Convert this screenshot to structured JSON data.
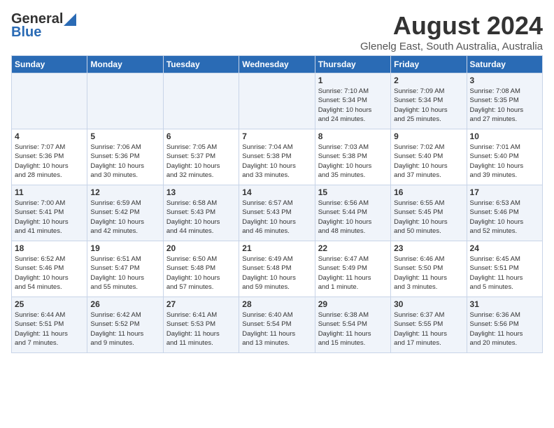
{
  "header": {
    "logo_general": "General",
    "logo_blue": "Blue",
    "title": "August 2024",
    "subtitle": "Glenelg East, South Australia, Australia"
  },
  "calendar": {
    "weekdays": [
      "Sunday",
      "Monday",
      "Tuesday",
      "Wednesday",
      "Thursday",
      "Friday",
      "Saturday"
    ],
    "weeks": [
      [
        {
          "day": "",
          "info": ""
        },
        {
          "day": "",
          "info": ""
        },
        {
          "day": "",
          "info": ""
        },
        {
          "day": "",
          "info": ""
        },
        {
          "day": "1",
          "info": "Sunrise: 7:10 AM\nSunset: 5:34 PM\nDaylight: 10 hours\nand 24 minutes."
        },
        {
          "day": "2",
          "info": "Sunrise: 7:09 AM\nSunset: 5:34 PM\nDaylight: 10 hours\nand 25 minutes."
        },
        {
          "day": "3",
          "info": "Sunrise: 7:08 AM\nSunset: 5:35 PM\nDaylight: 10 hours\nand 27 minutes."
        }
      ],
      [
        {
          "day": "4",
          "info": "Sunrise: 7:07 AM\nSunset: 5:36 PM\nDaylight: 10 hours\nand 28 minutes."
        },
        {
          "day": "5",
          "info": "Sunrise: 7:06 AM\nSunset: 5:36 PM\nDaylight: 10 hours\nand 30 minutes."
        },
        {
          "day": "6",
          "info": "Sunrise: 7:05 AM\nSunset: 5:37 PM\nDaylight: 10 hours\nand 32 minutes."
        },
        {
          "day": "7",
          "info": "Sunrise: 7:04 AM\nSunset: 5:38 PM\nDaylight: 10 hours\nand 33 minutes."
        },
        {
          "day": "8",
          "info": "Sunrise: 7:03 AM\nSunset: 5:38 PM\nDaylight: 10 hours\nand 35 minutes."
        },
        {
          "day": "9",
          "info": "Sunrise: 7:02 AM\nSunset: 5:40 PM\nDaylight: 10 hours\nand 37 minutes."
        },
        {
          "day": "10",
          "info": "Sunrise: 7:01 AM\nSunset: 5:40 PM\nDaylight: 10 hours\nand 39 minutes."
        }
      ],
      [
        {
          "day": "11",
          "info": "Sunrise: 7:00 AM\nSunset: 5:41 PM\nDaylight: 10 hours\nand 41 minutes."
        },
        {
          "day": "12",
          "info": "Sunrise: 6:59 AM\nSunset: 5:42 PM\nDaylight: 10 hours\nand 42 minutes."
        },
        {
          "day": "13",
          "info": "Sunrise: 6:58 AM\nSunset: 5:43 PM\nDaylight: 10 hours\nand 44 minutes."
        },
        {
          "day": "14",
          "info": "Sunrise: 6:57 AM\nSunset: 5:43 PM\nDaylight: 10 hours\nand 46 minutes."
        },
        {
          "day": "15",
          "info": "Sunrise: 6:56 AM\nSunset: 5:44 PM\nDaylight: 10 hours\nand 48 minutes."
        },
        {
          "day": "16",
          "info": "Sunrise: 6:55 AM\nSunset: 5:45 PM\nDaylight: 10 hours\nand 50 minutes."
        },
        {
          "day": "17",
          "info": "Sunrise: 6:53 AM\nSunset: 5:46 PM\nDaylight: 10 hours\nand 52 minutes."
        }
      ],
      [
        {
          "day": "18",
          "info": "Sunrise: 6:52 AM\nSunset: 5:46 PM\nDaylight: 10 hours\nand 54 minutes."
        },
        {
          "day": "19",
          "info": "Sunrise: 6:51 AM\nSunset: 5:47 PM\nDaylight: 10 hours\nand 55 minutes."
        },
        {
          "day": "20",
          "info": "Sunrise: 6:50 AM\nSunset: 5:48 PM\nDaylight: 10 hours\nand 57 minutes."
        },
        {
          "day": "21",
          "info": "Sunrise: 6:49 AM\nSunset: 5:48 PM\nDaylight: 10 hours\nand 59 minutes."
        },
        {
          "day": "22",
          "info": "Sunrise: 6:47 AM\nSunset: 5:49 PM\nDaylight: 11 hours\nand 1 minute."
        },
        {
          "day": "23",
          "info": "Sunrise: 6:46 AM\nSunset: 5:50 PM\nDaylight: 11 hours\nand 3 minutes."
        },
        {
          "day": "24",
          "info": "Sunrise: 6:45 AM\nSunset: 5:51 PM\nDaylight: 11 hours\nand 5 minutes."
        }
      ],
      [
        {
          "day": "25",
          "info": "Sunrise: 6:44 AM\nSunset: 5:51 PM\nDaylight: 11 hours\nand 7 minutes."
        },
        {
          "day": "26",
          "info": "Sunrise: 6:42 AM\nSunset: 5:52 PM\nDaylight: 11 hours\nand 9 minutes."
        },
        {
          "day": "27",
          "info": "Sunrise: 6:41 AM\nSunset: 5:53 PM\nDaylight: 11 hours\nand 11 minutes."
        },
        {
          "day": "28",
          "info": "Sunrise: 6:40 AM\nSunset: 5:54 PM\nDaylight: 11 hours\nand 13 minutes."
        },
        {
          "day": "29",
          "info": "Sunrise: 6:38 AM\nSunset: 5:54 PM\nDaylight: 11 hours\nand 15 minutes."
        },
        {
          "day": "30",
          "info": "Sunrise: 6:37 AM\nSunset: 5:55 PM\nDaylight: 11 hours\nand 17 minutes."
        },
        {
          "day": "31",
          "info": "Sunrise: 6:36 AM\nSunset: 5:56 PM\nDaylight: 11 hours\nand 20 minutes."
        }
      ]
    ]
  }
}
